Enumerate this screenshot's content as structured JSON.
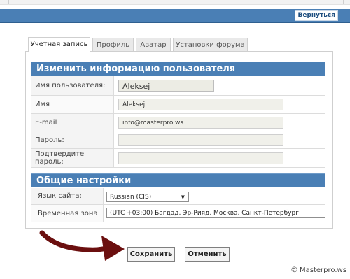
{
  "header": {
    "back_label": "Вернуться",
    "accent": "#4a7fb5"
  },
  "tabs": [
    {
      "label": "Учетная запись",
      "active": true
    },
    {
      "label": "Профиль",
      "active": false
    },
    {
      "label": "Аватар",
      "active": false
    },
    {
      "label": "Установки форума",
      "active": false
    }
  ],
  "account_section": {
    "title": "Изменить информацию пользователя",
    "fields": {
      "username": {
        "label": "Имя пользователя:",
        "value": "Aleksej"
      },
      "name": {
        "label": "Имя",
        "value": "Aleksej"
      },
      "email": {
        "label": "E-mail",
        "value": "info@masterpro.ws"
      },
      "password": {
        "label": "Пароль:",
        "value": ""
      },
      "confirm_password": {
        "label": "Подтвердите пароль:",
        "value": ""
      }
    }
  },
  "general_section": {
    "title": "Общие настройки",
    "site_language": {
      "label": "Язык сайта:",
      "value": "Russian (CIS)"
    },
    "timezone": {
      "label": "Временная зона",
      "value": "(UTC +03:00) Багдад, Эр-Рияд, Москва, Санкт-Петербург"
    }
  },
  "actions": {
    "save_label": "Сохранить",
    "cancel_label": "Отменить"
  },
  "watermark": {
    "symbol": "©",
    "text": "Masterpro.ws"
  },
  "annotation": {
    "arrow_color": "#6b0f0f"
  }
}
